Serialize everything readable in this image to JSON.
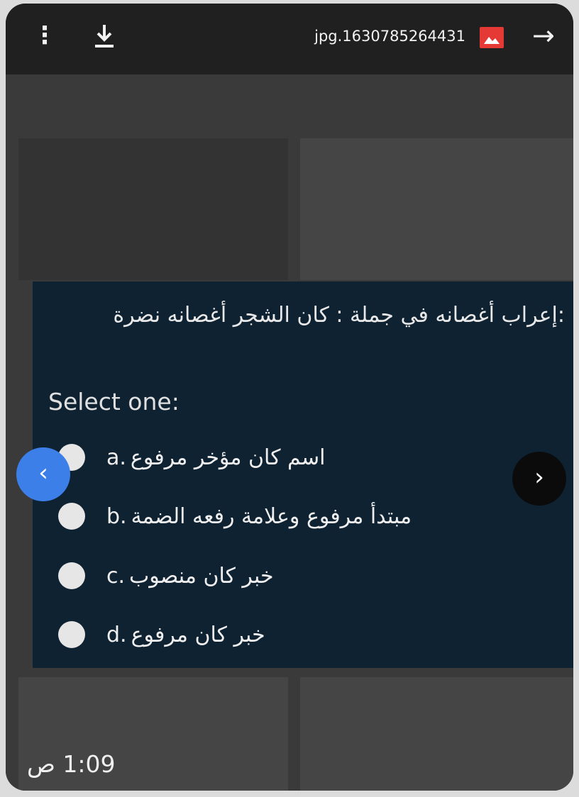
{
  "viewer": {
    "filename": "jpg.1630785264431",
    "icons": {
      "more": "more-vert-icon",
      "download": "download-icon",
      "image": "image-icon",
      "forward": "arrow-right-icon"
    }
  },
  "quiz": {
    "question": ":إعراب أغصانه في جملة : كان الشجر أغصانه نضرة",
    "select_label": "Select one:",
    "options": [
      {
        "letter": "a.",
        "text": "اسم كان مؤخر مرفوع"
      },
      {
        "letter": "b.",
        "text": "مبتدأ مرفوع وعلامة رفعه الضمة"
      },
      {
        "letter": "c.",
        "text": "خبر كان منصوب"
      },
      {
        "letter": "d.",
        "text": "خبر كان مرفوع"
      }
    ]
  },
  "nav": {
    "prev": "‹",
    "next": "›"
  },
  "status": {
    "time": "1:09 ص"
  },
  "colors": {
    "panel": "#0e2232",
    "prev_button": "#3d7fe8",
    "image_icon": "#e53935"
  }
}
